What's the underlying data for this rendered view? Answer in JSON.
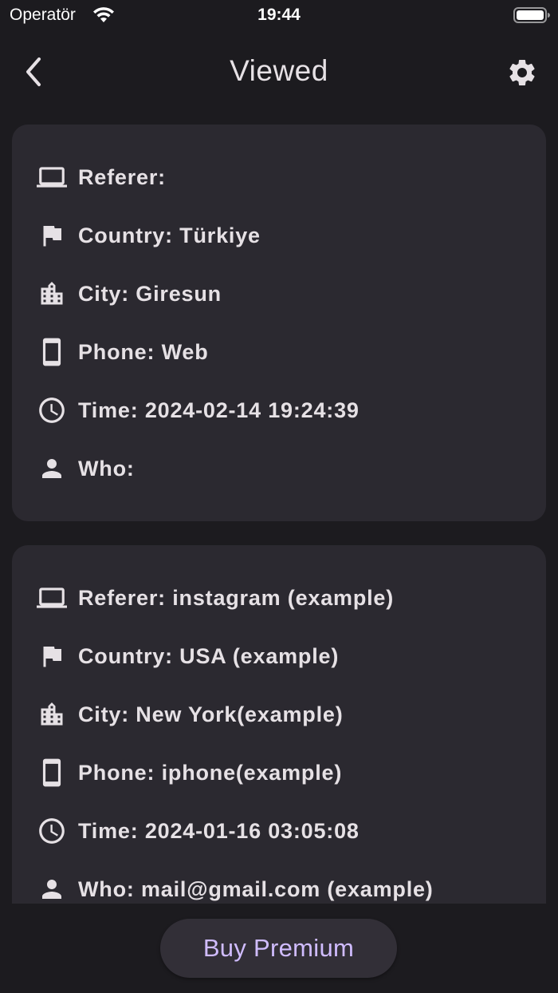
{
  "status_bar": {
    "carrier": "Operatör",
    "time": "19:44"
  },
  "app_bar": {
    "title": "Viewed",
    "back_icon": "chevron-left-icon",
    "settings_icon": "gear-icon"
  },
  "views": [
    {
      "referer": "Referer:",
      "country": "Country: Türkiye",
      "city": "City: Giresun",
      "phone": "Phone: Web",
      "time": "Time: 2024-02-14 19:24:39",
      "who": "Who:"
    },
    {
      "referer": "Referer: instagram (example)",
      "country": "Country: USA (example)",
      "city": "City: New York(example)",
      "phone": "Phone: iphone(example)",
      "time": "Time: 2024-01-16 03:05:08",
      "who": "Who: mail@gmail.com (example)"
    }
  ],
  "icons": {
    "referer": "laptop-icon",
    "country": "flag-icon",
    "city": "city-icon",
    "phone": "phone-icon",
    "time": "clock-icon",
    "who": "person-icon"
  },
  "premium_button": {
    "label": "Buy Premium"
  },
  "colors": {
    "background": "#1c1b1f",
    "card": "#2b2930",
    "text": "#e6e1e5",
    "accent": "#d0bcff"
  }
}
